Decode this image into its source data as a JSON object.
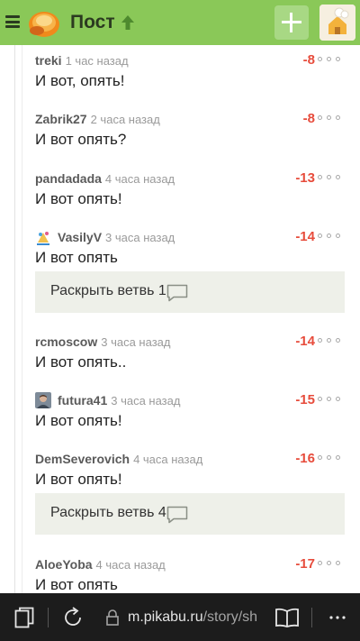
{
  "header": {
    "title": "Пост",
    "brand_color": "#8ac858"
  },
  "comments": [
    {
      "user": "treki",
      "time": "1 час назад",
      "rating": "-8",
      "text": "И вот, опять!"
    },
    {
      "user": "Zabrik27",
      "time": "2 часа назад",
      "rating": "-8",
      "text": "И вот опять?"
    },
    {
      "user": "pandadada",
      "time": "4 часа назад",
      "rating": "-13",
      "text": "И вот опять!"
    },
    {
      "user": "VasilyV",
      "time": "3 часа назад",
      "rating": "-14",
      "text": "И вот опять"
    },
    {
      "user": "rcmoscow",
      "time": "3 часа назад",
      "rating": "-14",
      "text": "И вот опять.."
    },
    {
      "user": "futura41",
      "time": "3 часа назад",
      "rating": "-15",
      "text": "И вот опять!"
    },
    {
      "user": "DemSeverovich",
      "time": "4 часа назад",
      "rating": "-16",
      "text": "И вот опять!"
    },
    {
      "user": "AloeYoba",
      "time": "4 часа назад",
      "rating": "-17",
      "text": "И вот опять"
    }
  ],
  "expand_branches": [
    {
      "label": "Раскрыть ветвь 1"
    },
    {
      "label": "Раскрыть ветвь 4"
    }
  ],
  "browser": {
    "url_host": "m.pikabu.ru",
    "url_path": "/story/sh"
  },
  "colors": {
    "rating_negative": "#e74c3c",
    "expand_bg": "#eef0e9",
    "bottom_bar": "#1c1c1c"
  }
}
